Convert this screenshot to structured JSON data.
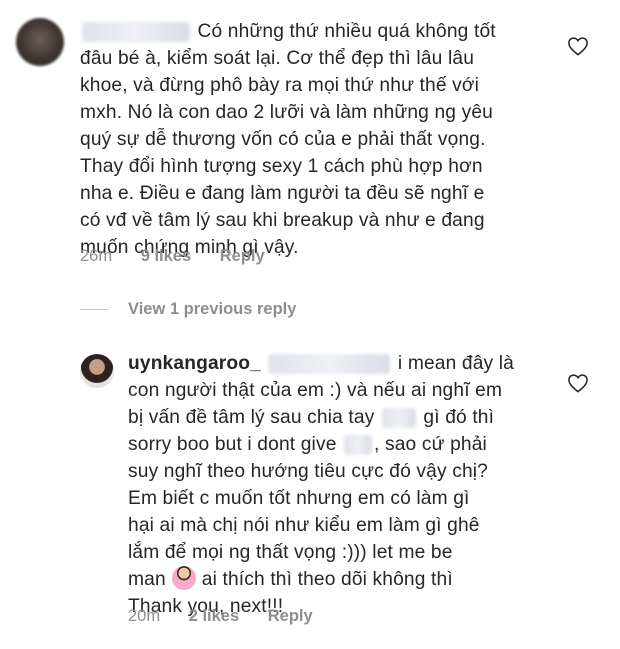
{
  "comments": [
    {
      "username": "",
      "lines": [
        "Có những thứ nhiều quá không tốt",
        "đâu bé à, kiểm soát lại. Cơ thể đẹp thì lâu lâu",
        "khoe, và đừng phô bày ra mọi thứ như thế với",
        "mxh. Nó là con dao 2 lưỡi và làm những ng yêu",
        "quý sự dễ thương vốn có của e phải thất vọng.",
        "Thay đổi hình tượng sexy 1 cách phù hợp hơn",
        "nha e. Điều e đang làm người ta đều sẽ nghĩ e",
        "có vđ về tâm lý sau khi breakup và như e đang",
        "muốn chứng minh gì vậy."
      ],
      "time": "26m",
      "likes": "9 likes",
      "reply_label": "Reply"
    },
    {
      "username": "uynkangaroo_",
      "lines_a": "i mean đây là",
      "line2": "con người thật của em :) và nếu ai nghĩ em",
      "line3_a": "bị vấn đề tâm lý sau chia tay",
      "line3_b": "gì đó thì",
      "line4_a": "sorry boo but i dont give",
      "line4_b": ", sao cứ phải",
      "line5": "suy nghĩ theo hướng tiêu cực đó vậy chị?",
      "line6": "Em biết c muốn tốt nhưng em có làm gì",
      "line7": "hại ai mà chị nói như kiểu em làm gì ghê",
      "line8": "lắm để mọi ng thất vọng :))) let me be",
      "line9_a": "man",
      "line9_b": "ai thích thì theo dõi không thì",
      "line10": "Thank you, next!!!",
      "time": "20m",
      "likes": "2 likes",
      "reply_label": "Reply"
    }
  ],
  "view_replies": "View 1 previous reply",
  "icons": {
    "like": "heart-outline-icon",
    "emoji": "person-tipping-hand-emoji"
  },
  "colors": {
    "text": "#262626",
    "meta": "#8e8e8e"
  }
}
